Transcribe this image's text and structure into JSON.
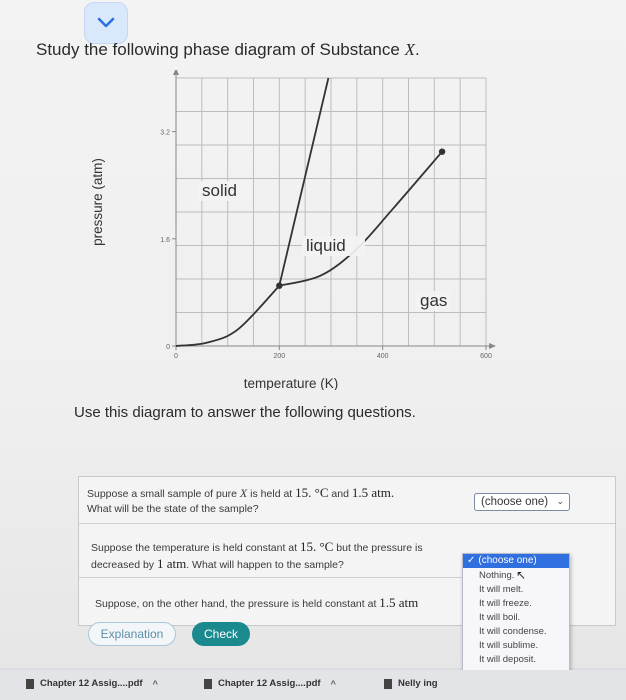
{
  "prompt": {
    "text": "Study the following phase diagram of Substance ",
    "var": "X",
    "end": "."
  },
  "chart_data": {
    "type": "diagram",
    "xlabel": "temperature (K)",
    "ylabel": "pressure (atm)",
    "xticks": [
      "0",
      "200",
      "400",
      "600"
    ],
    "yticks": [
      "0",
      "1.6",
      "3.2"
    ],
    "xlim": [
      0,
      600
    ],
    "ylim": [
      0,
      4
    ],
    "grid": true,
    "regions": {
      "solid": "solid",
      "liquid": "liquid",
      "gas": "gas"
    },
    "triple_point": {
      "x": 200,
      "y": 0.9
    },
    "critical_point": {
      "x": 515,
      "y": 2.9
    },
    "curves": {
      "sublimation": [
        [
          0,
          0
        ],
        [
          60,
          0.05
        ],
        [
          120,
          0.25
        ],
        [
          200,
          0.9
        ]
      ],
      "vaporization": [
        [
          200,
          0.9
        ],
        [
          280,
          1.05
        ],
        [
          350,
          1.45
        ],
        [
          420,
          2.05
        ],
        [
          515,
          2.9
        ]
      ],
      "fusion": [
        [
          200,
          0.9
        ],
        [
          295,
          4.0
        ]
      ]
    }
  },
  "instructions": "Use this diagram to answer the following questions.",
  "questions": [
    {
      "text_a": "Suppose a small sample of pure ",
      "var": "X",
      "text_b": " is held at ",
      "temp": "15. °C",
      "text_c": " and ",
      "press": "1.5 atm.",
      "line2": "What will be the state of the sample?"
    },
    {
      "text_a": "Suppose the temperature is held constant at ",
      "temp": "15. °C",
      "text_b": " but the pressure is",
      "line2a": "decreased by ",
      "amount": "1 atm",
      "line2b": ". What will happen to the sample?"
    },
    {
      "text_a": "Suppose, on the other hand, the pressure is held constant at ",
      "press": "1.5 atm"
    }
  ],
  "select": {
    "value": "(choose one)"
  },
  "dropdown": {
    "selected": "(choose one)",
    "options": [
      "Nothing.",
      "It will melt.",
      "It will freeze.",
      "It will boil.",
      "It will condense.",
      "It will sublime.",
      "It will deposit."
    ]
  },
  "buttons": {
    "explanation": "Explanation",
    "check": "Check"
  },
  "downloads": [
    {
      "name": "Chapter 12 Assig....pdf"
    },
    {
      "name": "Chapter 12 Assig....pdf"
    },
    {
      "name": "Nelly ing"
    }
  ],
  "colors": {
    "curve": "#333333",
    "grid": "#bdbdbd",
    "accent": "#1a8a8f",
    "select_highlight": "#2f6fe0"
  }
}
